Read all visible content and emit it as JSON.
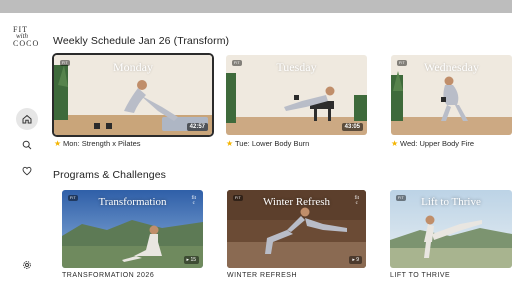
{
  "logo": {
    "line1": "FIT",
    "line2": "with",
    "line3": "COCO"
  },
  "nav": {
    "home_icon": "home-icon",
    "search_icon": "search-icon",
    "favorites_icon": "heart-icon",
    "settings_icon": "gear-icon"
  },
  "weekly": {
    "title": "Weekly Schedule Jan 26 (Transform)",
    "cards": [
      {
        "day": "Monday",
        "caption": "Mon: Strength x Pilates",
        "duration": "42:57",
        "selected": true
      },
      {
        "day": "Tuesday",
        "caption": "Tue: Lower Body Burn",
        "duration": "43:05",
        "selected": false
      },
      {
        "day": "Wednesday",
        "caption": "Wed: Upper Body Fire",
        "duration": "",
        "selected": false
      }
    ]
  },
  "programs": {
    "title": "Programs & Challenges",
    "cards": [
      {
        "title": "Transformation",
        "caption": "TRANSFORMATION 2026",
        "count": "15"
      },
      {
        "title": "Winter Refresh",
        "caption": "WINTER REFRESH",
        "count": "9"
      },
      {
        "title": "Lift to Thrive",
        "caption": "LIFT TO THRIVE",
        "count": ""
      }
    ]
  },
  "colors": {
    "accent_star": "#f4b400",
    "selected_outline": "#2b2b2b",
    "status_bar": "#bdbdbd"
  }
}
